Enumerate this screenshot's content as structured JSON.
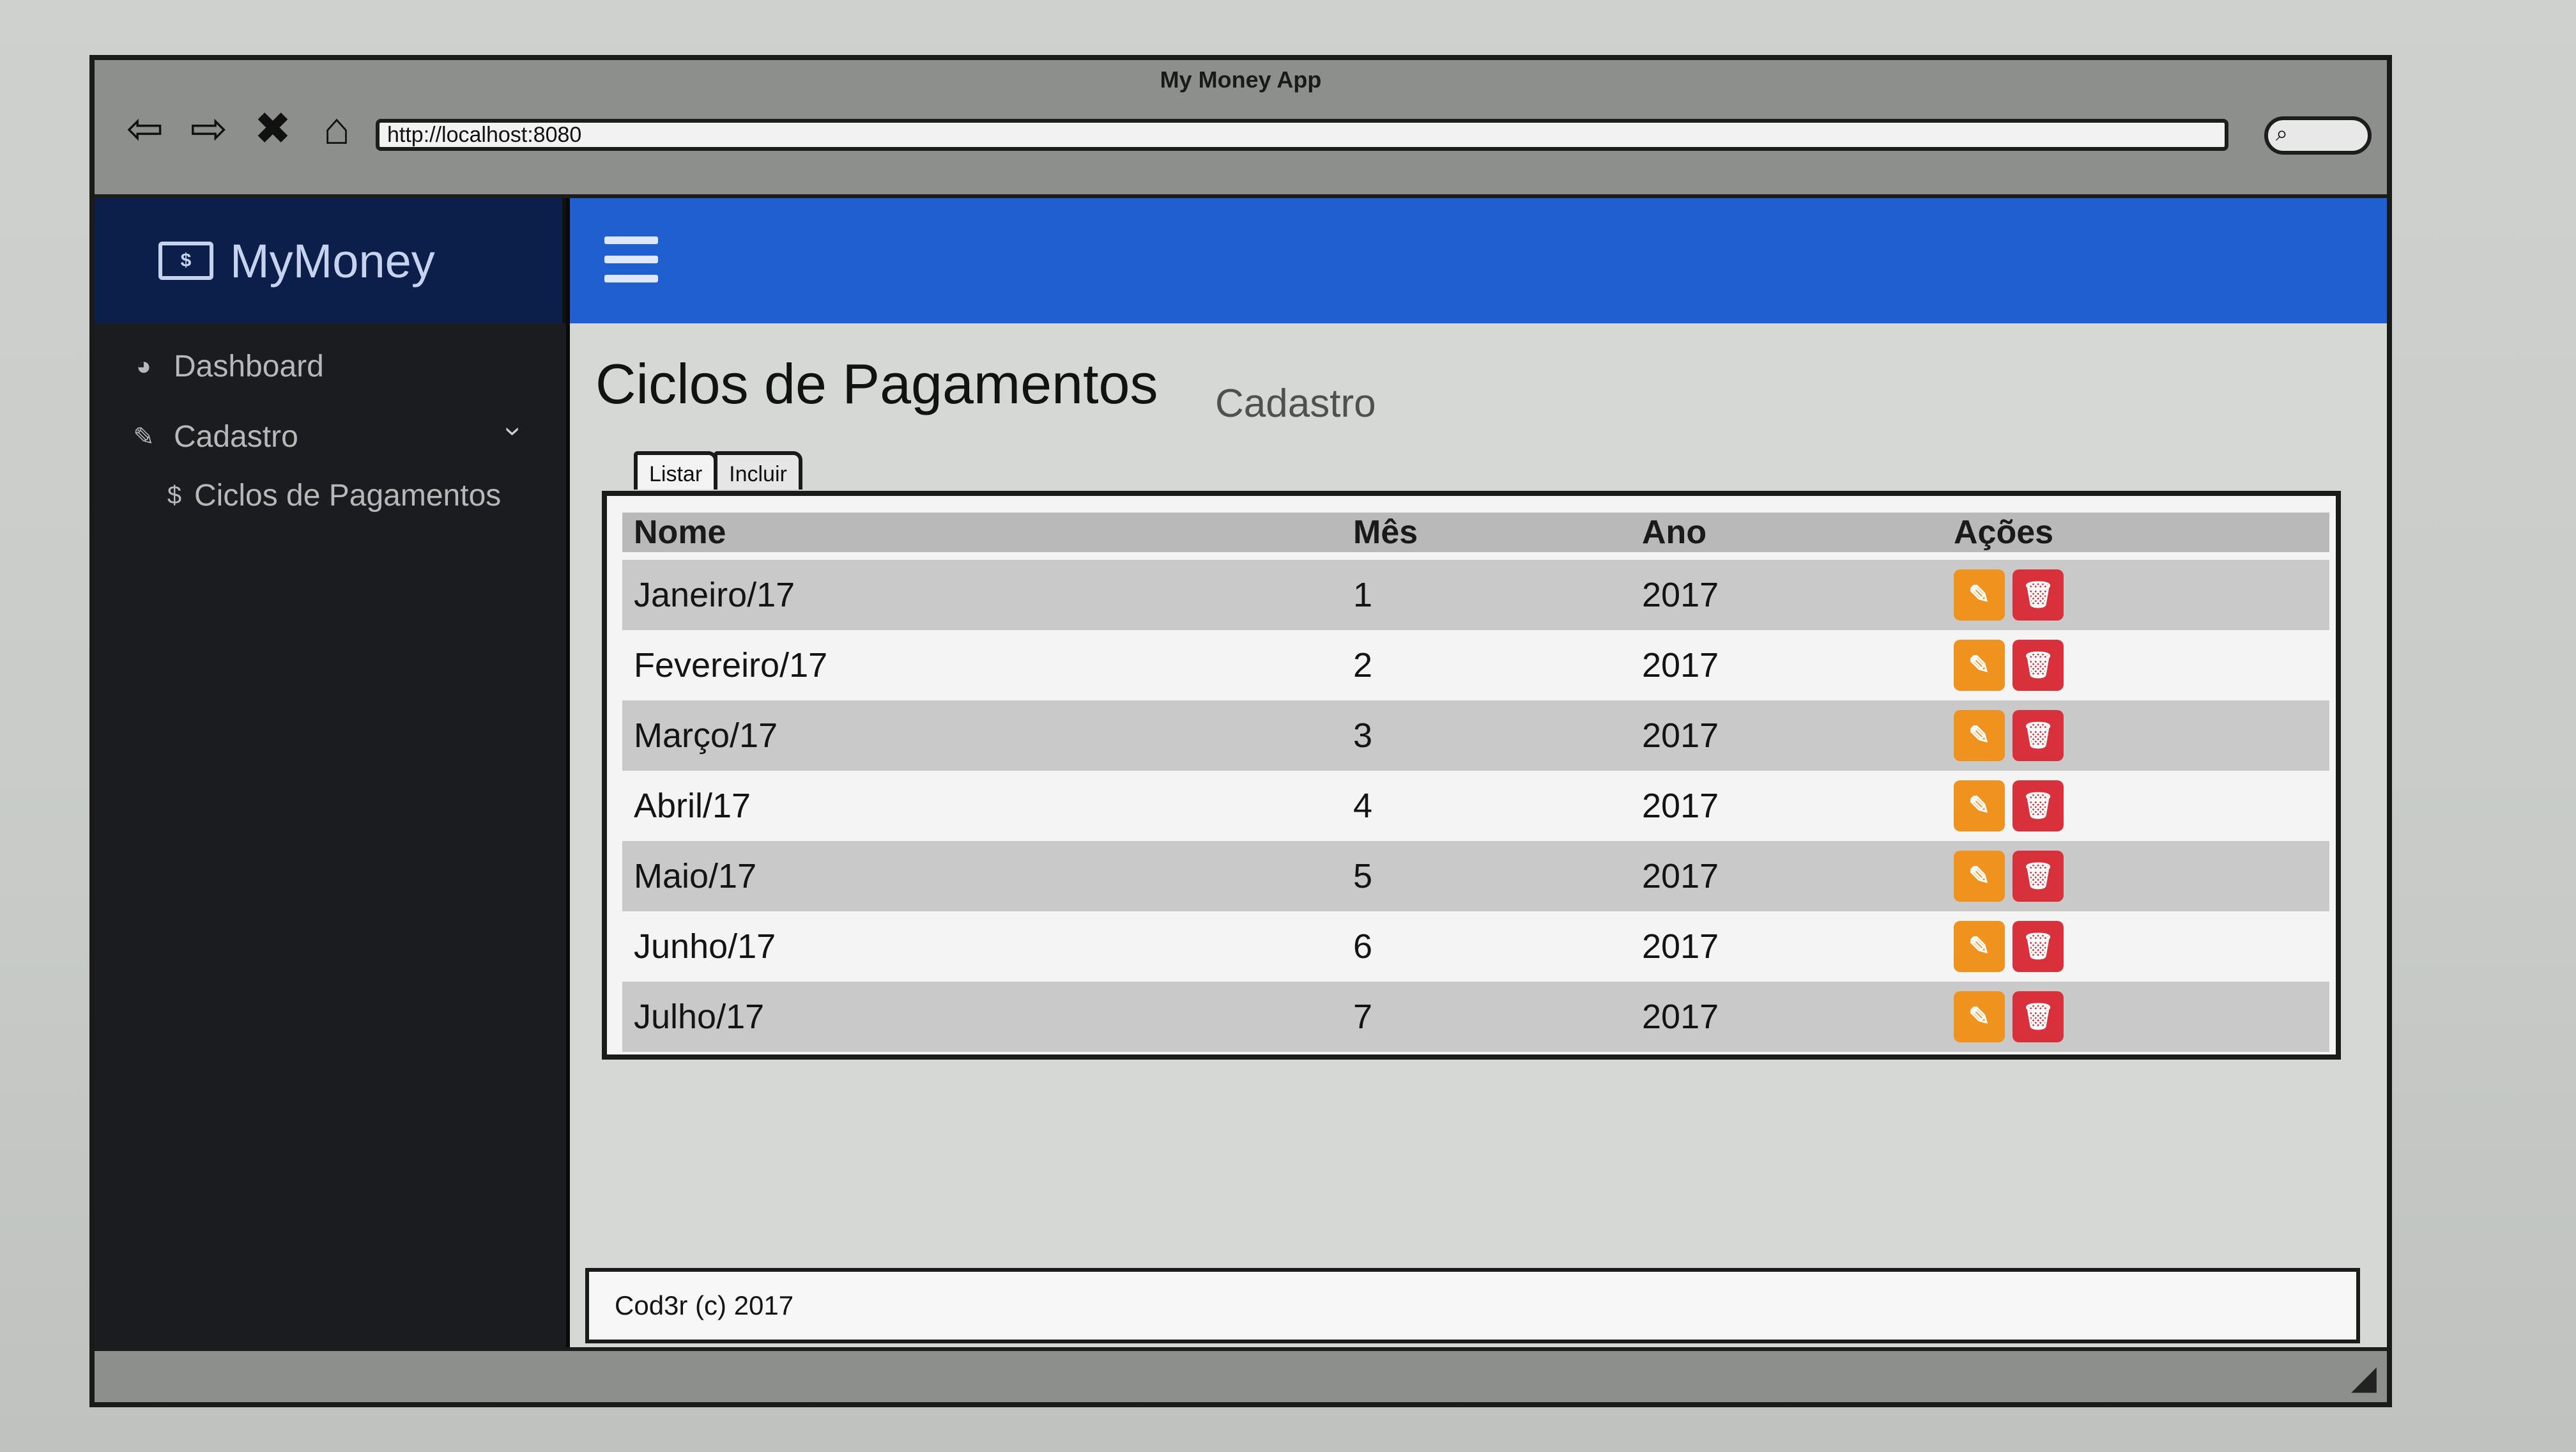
{
  "window": {
    "title": "My Money App"
  },
  "browser": {
    "url": "http://localhost:8080",
    "nav_icons": [
      "back-arrow-icon",
      "forward-arrow-icon",
      "close-icon",
      "home-icon"
    ],
    "search_icon": "search-icon"
  },
  "brand": {
    "name": "MyMoney",
    "icon": "money-icon"
  },
  "topbar": {
    "menu_icon": "hamburger-icon",
    "color": "#1f5fcf"
  },
  "sidebar": {
    "items": [
      {
        "label": "Dashboard",
        "icon": "dashboard-icon"
      },
      {
        "label": "Cadastro",
        "icon": "edit-icon",
        "expanded": true
      },
      {
        "label": "Ciclos de Pagamentos",
        "icon": "dollar-icon"
      }
    ]
  },
  "page": {
    "title": "Ciclos de Pagamentos",
    "subtitle": "Cadastro",
    "tabs": [
      {
        "label": "Listar",
        "active": true
      },
      {
        "label": "Incluir",
        "active": false
      }
    ]
  },
  "table": {
    "headers": [
      "Nome",
      "Mês",
      "Ano",
      "Ações"
    ],
    "rows": [
      {
        "nome": "Janeiro/17",
        "mes": "1",
        "ano": "2017"
      },
      {
        "nome": "Fevereiro/17",
        "mes": "2",
        "ano": "2017"
      },
      {
        "nome": "Março/17",
        "mes": "3",
        "ano": "2017"
      },
      {
        "nome": "Abril/17",
        "mes": "4",
        "ano": "2017"
      },
      {
        "nome": "Maio/17",
        "mes": "5",
        "ano": "2017"
      },
      {
        "nome": "Junho/17",
        "mes": "6",
        "ano": "2017"
      },
      {
        "nome": "Julho/17",
        "mes": "7",
        "ano": "2017"
      }
    ],
    "action_icons": {
      "edit": "pencil-icon",
      "delete": "trash-icon"
    },
    "colors": {
      "edit": "#f0921e",
      "delete": "#d9313b"
    }
  },
  "footer": {
    "text": "Cod3r (c) 2017"
  }
}
